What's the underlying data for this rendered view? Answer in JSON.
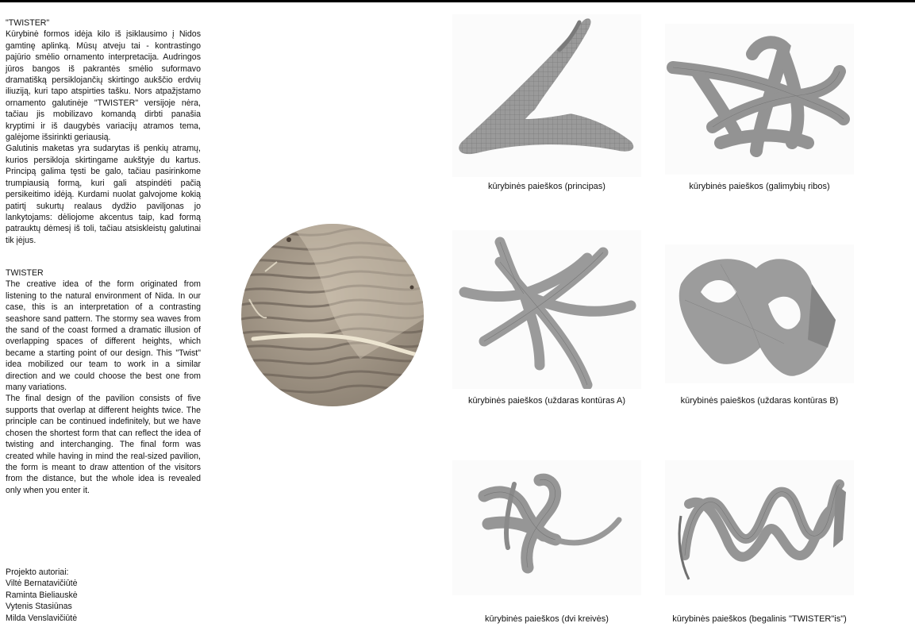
{
  "lt": {
    "title": "\"TWISTER\"",
    "p1": "Kūrybinė formos idėja kilo iš įsiklausimo į Nidos gamtinę aplinką. Mūsų atveju tai - kontrastingo pajūrio smėlio ornamento interpretacija. Audringos jūros bangos iš pakrantės smėlio suformavo dramatišką persiklojančių skirtingo aukščio erdvių iliuziją, kuri tapo atspirties tašku. Nors atpažįstamo ornamento galutinėje \"TWISTER\" versijoje nėra, tačiau jis mobilizavo komandą dirbti panašia kryptimi ir iš daugybės variacijų atramos tema, galėjome išsirinkti geriausią.",
    "p2": "Galutinis maketas yra sudarytas iš penkių atramų, kurios persikloja skirtingame aukštyje du kartus. Principą galima tęsti be galo, tačiau pasirinkome trumpiausią formą, kuri gali atspindėti pačią persikeitimo idėją. Kurdami nuolat galvojome kokią patirtį sukurtų realaus dydžio paviljonas jo lankytojams: dėliojome akcentus taip, kad formą patrauktų dėmesį iš toli, tačiau atsiskleistų galutinai tik įėjus."
  },
  "en": {
    "title": "TWISTER",
    "p1": "The creative idea of the form originated from listening to the natural environment of Nida. In our case, this is an interpretation of a contrasting seashore sand pattern. The stormy sea waves from the sand of the coast formed a dramatic illusion of overlapping spaces of different heights, which became a starting point of our design. This \"Twist\" idea mobilized our team to work in a similar direction and we could choose the best one from many variations.",
    "p2": "The final design of the pavilion consists of five supports that overlap at different heights twice. The principle can be continued indefinitely, but we have chosen the shortest form that can reflect the idea of twisting and interchanging. The final form was created while having in mind the real-sized pavilion, the form is meant to draw attention of the visitors from the distance, but the whole idea is revealed only when you enter it."
  },
  "authors": {
    "heading": "Projekto autoriai:",
    "names": [
      "Viltė Bernatavičiūtė",
      "Raminta Bieliauskė",
      "Vytenis Stasiūnas",
      "Milda Venslavičiūtė"
    ]
  },
  "captions": [
    "kūrybinės paieškos (principas)",
    "kūrybinės paieškos (galimybių ribos)",
    "kūrybinės paieškos (uždaras kontūras A)",
    "kūrybinės paieškos (uždaras kontūras B)",
    "kūrybinės paieškos (dvi kreivės)",
    "kūrybinės paieškos (begalinis \"TWISTER\"is\")"
  ]
}
